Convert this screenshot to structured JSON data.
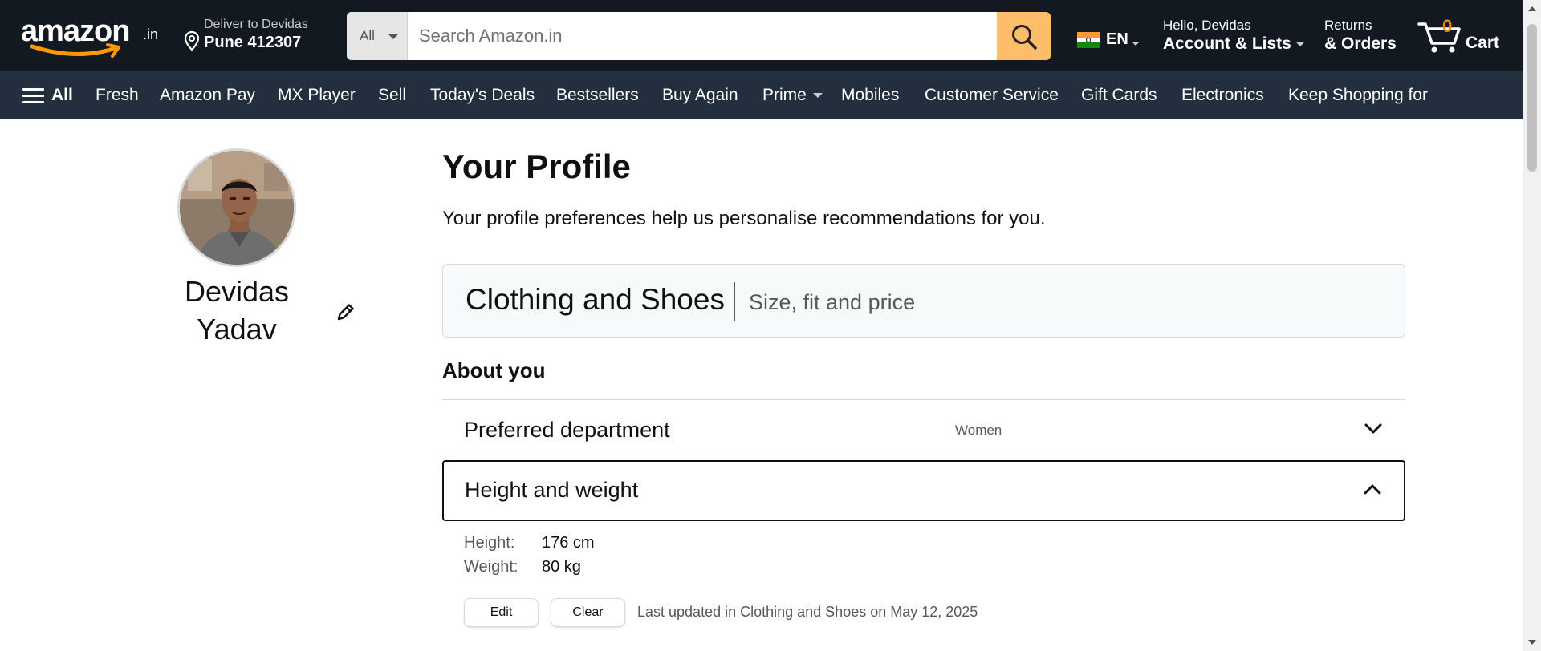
{
  "header": {
    "logo_text": "amazon",
    "logo_suffix": ".in",
    "deliver_line1": "Deliver to Devidas",
    "deliver_line2": "Pune 412307",
    "search_category": "All",
    "search_placeholder": "Search Amazon.in",
    "language": "EN",
    "account_line1": "Hello, Devidas",
    "account_line2": "Account & Lists",
    "orders_line1": "Returns",
    "orders_line2": "& Orders",
    "cart_count": "0",
    "cart_label": "Cart",
    "accent_color": "#febd69",
    "bg_color": "#131921"
  },
  "subnav": {
    "all_label": "All",
    "items": [
      "Fresh",
      "Amazon Pay",
      "MX Player",
      "Sell",
      "Today's Deals",
      "Bestsellers",
      "Buy Again",
      "Prime",
      "Mobiles",
      "Customer Service",
      "Gift Cards",
      "Electronics",
      "Keep Shopping for"
    ],
    "bg_color": "#232f3e"
  },
  "profile": {
    "first_name": "Devidas",
    "last_name": "Yadav"
  },
  "main": {
    "title": "Your Profile",
    "description": "Your profile preferences help us personalise recommendations for you.",
    "category_title": "Clothing and Shoes",
    "category_subtitle": "Size, fit and price",
    "section_title": "About you",
    "rows": [
      {
        "label": "Preferred department",
        "value": "Women",
        "expanded": false
      },
      {
        "label": "Height and weight",
        "value": "",
        "expanded": true
      }
    ],
    "details": [
      {
        "key": "Height:",
        "value": "176 cm"
      },
      {
        "key": "Weight:",
        "value": "80 kg"
      }
    ],
    "edit_label": "Edit",
    "clear_label": "Clear",
    "last_updated": "Last updated in Clothing and Shoes on May 12, 2025"
  }
}
